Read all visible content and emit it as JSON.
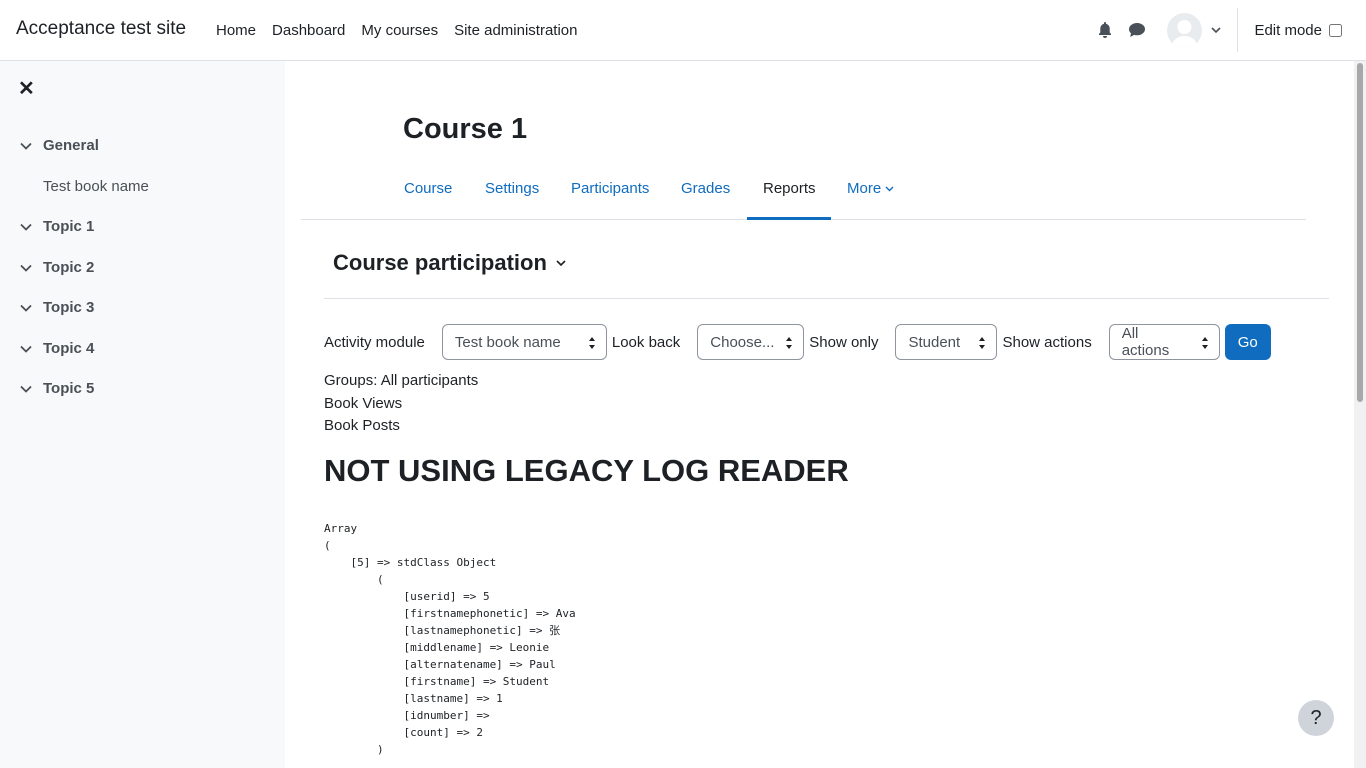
{
  "navbar": {
    "site_name": "Acceptance test site",
    "links": [
      "Home",
      "Dashboard",
      "My courses",
      "Site administration"
    ],
    "edit_mode_label": "Edit mode"
  },
  "drawer": {
    "sections": [
      "General",
      "Topic 1",
      "Topic 2",
      "Topic 3",
      "Topic 4",
      "Topic 5"
    ],
    "general_activity": "Test book name"
  },
  "course": {
    "title": "Course 1",
    "tabs": [
      "Course",
      "Settings",
      "Participants",
      "Grades",
      "Reports",
      "More"
    ],
    "active_tab": "Reports"
  },
  "report": {
    "heading": "Course participation",
    "form": {
      "activity_module_label": "Activity module",
      "activity_module_value": "Test book name",
      "look_back_label": "Look back",
      "look_back_value": "Choose...",
      "show_only_label": "Show only",
      "show_only_value": "Student",
      "show_actions_label": "Show actions",
      "show_actions_value": "All actions",
      "go_label": "Go"
    },
    "groups_line": "Groups: All participants",
    "book_views": "Book Views",
    "book_posts": "Book Posts",
    "legacy_heading": "NOT USING LEGACY LOG READER",
    "dump": "Array\n(\n    [5] => stdClass Object\n        (\n            [userid] => 5\n            [firstnamephonetic] => Ava\n            [lastnamephonetic] => 张\n            [middlename] => Leonie\n            [alternatename] => Paul\n            [firstname] => Student\n            [lastname] => 1\n            [idnumber] => \n            [count] => 2\n        )"
  },
  "help_label": "?"
}
